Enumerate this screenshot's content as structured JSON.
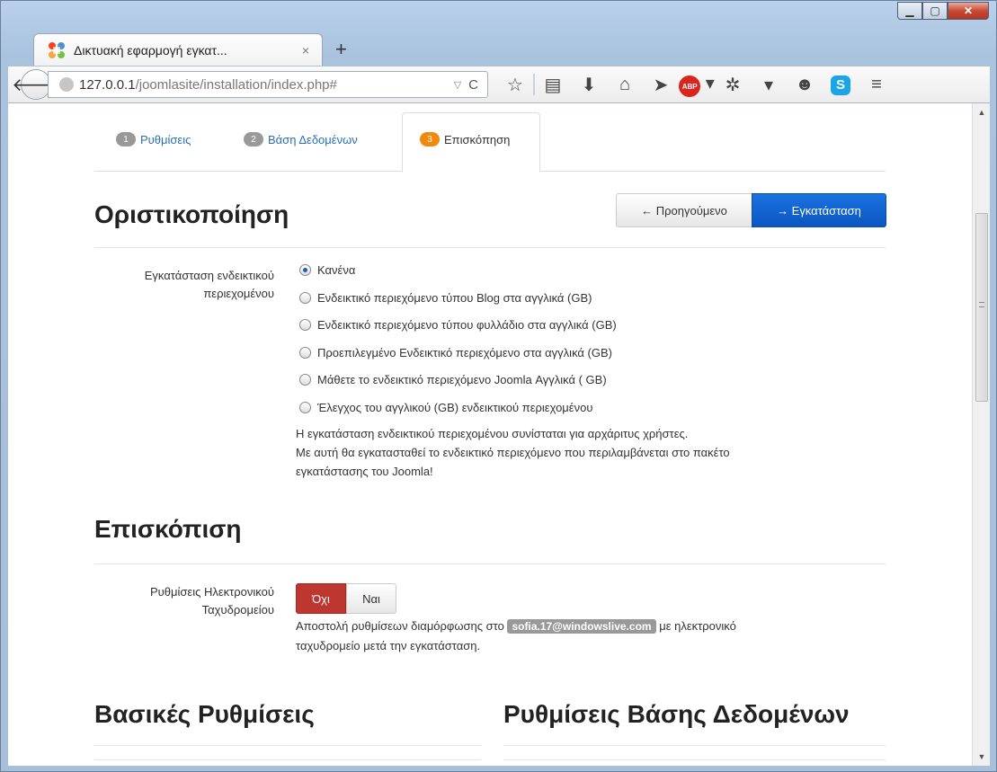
{
  "browser": {
    "tab_title": "Δικτυακή εφαρμογή εγκατ...",
    "tab_close": "×",
    "new_tab": "+",
    "url_host": "127.0.0.1",
    "url_path": "/joomlasite/installation/index.php#",
    "abp_label": "ABP",
    "skype_label": "S"
  },
  "steps": [
    {
      "num": "1",
      "label": "Ρυθμίσεις"
    },
    {
      "num": "2",
      "label": "Βάση Δεδομένων"
    },
    {
      "num": "3",
      "label": "Επισκόπηση"
    }
  ],
  "finalize": {
    "heading": "Οριστικοποίηση",
    "prev_button": "← Προηγούμενο",
    "install_button": "→ Εγκατάσταση",
    "sample_label_line1": "Εγκατάσταση ενδεικτικού",
    "sample_label_line2": "περιεχομένου",
    "options": [
      "Κανένα",
      "Ενδεικτικό περιεχόμενο τύπου Blog στα αγγλικά (GB)",
      "Ενδεικτικό περιεχόμενο τύπου φυλλάδιο στα αγγλικά (GB)",
      "Προεπιλεγμένο Ενδεικτικό περιεχόμενο στα αγγλικά (GB)",
      "Μάθετε το ενδεικτικό περιεχόμενο Joomla Αγγλικά ( GB)",
      "Έλεγχος του αγγλικού (GB) ενδεικτικού περιεχομένου"
    ],
    "selected_option": "Κανένα",
    "help_line1": "Η εγκατάσταση ενδεικτικού περιεχομένου συνίσταται για αρχάριτυς χρήστες.",
    "help_line2": "Με αυτή θα εγκατασταθεί το ενδεικτικό περιεχόμενο που περιλαμβάνεται στο πακέτο",
    "help_line3": "εγκατάστασης του Joomla!"
  },
  "overview": {
    "heading": "Επισκόπιση",
    "email_label_line1": "Ρυθμίσεις Ηλεκτρονικού",
    "email_label_line2": "Ταχυδρομείου",
    "toggle_no": "Όχι",
    "toggle_yes": "Ναι",
    "email_text_before": "Αποστολή ρυθμίσεων διαμόρφωσης στο",
    "email_address": "sofia.17@windowslive.com",
    "email_text_after": "με ηλεκτρονικό",
    "email_text_line2": "ταχυδρομείο μετά την εγκατάσταση."
  },
  "sections": {
    "basic_settings": "Βασικές Ρυθμίσεις",
    "db_settings": "Ρυθμίσεις Βάσης Δεδομένων"
  },
  "colors": {
    "accent_blue": "#0b56c2",
    "step_active": "#f0890d",
    "toggle_no_red": "#bd362f"
  }
}
